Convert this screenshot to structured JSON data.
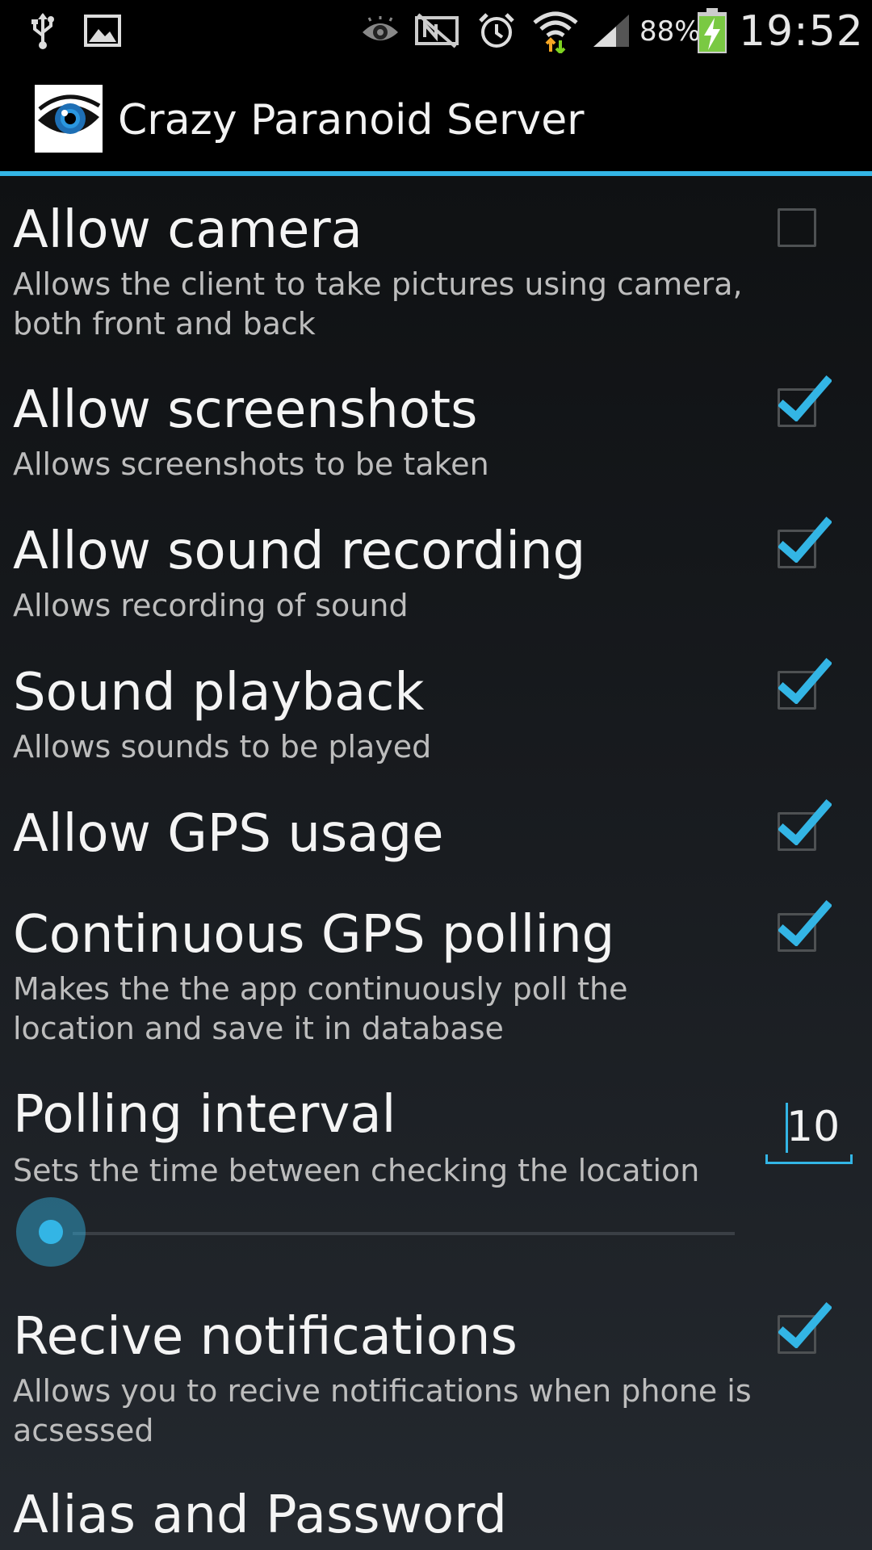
{
  "status_bar": {
    "icons": [
      "usb-icon",
      "gallery-icon",
      "eye-icon",
      "nfc-off-icon",
      "alarm-icon",
      "wifi-icon",
      "signal-icon",
      "battery-charging-icon"
    ],
    "battery_percent": "88%",
    "time": "19:52"
  },
  "action_bar": {
    "app_icon": "eye-logo-icon",
    "title": "Crazy Paranoid Server"
  },
  "colors": {
    "accent": "#33b5e5",
    "background_top": "#0f1113",
    "background_bottom": "#24292f"
  },
  "preferences": [
    {
      "title": "Allow camera",
      "summary": "Allows the client to take pictures using camera, both front and back",
      "checked": false
    },
    {
      "title": "Allow screenshots",
      "summary": "Allows screenshots to be taken",
      "checked": true
    },
    {
      "title": "Allow sound recording",
      "summary": "Allows recording of sound",
      "checked": true
    },
    {
      "title": "Sound playback",
      "summary": "Allows sounds to be played",
      "checked": true
    },
    {
      "title": "Allow GPS usage",
      "checked": true
    },
    {
      "title": "Continuous GPS polling",
      "summary": "Makes the the app continuously poll the location and save it in database",
      "checked": true
    },
    {
      "title": "Polling interval",
      "summary": "Sets the time between checking the location",
      "value": "10",
      "slider_position": 0.0
    },
    {
      "title": "Recive notifications",
      "summary": "Allows you to recive notifications when phone is acsessed",
      "checked": true
    },
    {
      "title": "Alias and Password"
    }
  ]
}
